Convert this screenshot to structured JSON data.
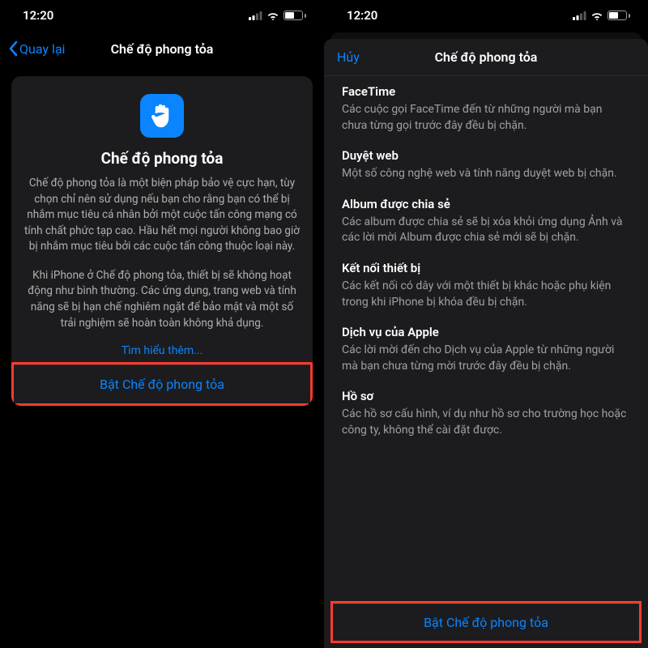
{
  "status": {
    "time": "12:20",
    "battery_pct": "48"
  },
  "left": {
    "nav_back": "Quay lại",
    "nav_title": "Chế độ phong tỏa",
    "card_title": "Chế độ phong tỏa",
    "card_para1": "Chế độ phong tỏa là một biện pháp bảo vệ cực hạn, tùy chọn chỉ nên sử dụng nếu bạn cho rằng bạn có thể bị nhắm mục tiêu cá nhân bởi một cuộc tấn công mạng có tính chất phức tạp cao. Hầu hết mọi người không bao giờ bị nhắm mục tiêu bởi các cuộc tấn công thuộc loại này.",
    "card_para2": "Khi iPhone ở Chế độ phong tỏa, thiết bị sẽ không hoạt động như bình thường. Các ứng dụng, trang web và tính năng sẽ bị hạn chế nghiêm ngặt để bảo mật và một số trải nghiệm sẽ hoàn toàn không khả dụng.",
    "learn_more": "Tìm hiểu thêm...",
    "action": "Bật Chế độ phong tỏa"
  },
  "right": {
    "cancel": "Hủy",
    "modal_title": "Chế độ phong tỏa",
    "sections": [
      {
        "title": "FaceTime",
        "text": "Các cuộc gọi FaceTime đến từ những người mà bạn chưa từng gọi trước đây đều bị chặn."
      },
      {
        "title": "Duyệt web",
        "text": "Một số công nghệ web và tính năng duyệt web bị chặn."
      },
      {
        "title": "Album được chia sẻ",
        "text": "Các album được chia sẻ sẽ bị xóa khỏi ứng dụng Ảnh và các lời mời Album được chia sẻ mới sẽ bị chặn."
      },
      {
        "title": "Kết nối thiết bị",
        "text": "Các kết nối có dây với một thiết bị khác hoặc phụ kiện trong khi iPhone bị khóa đều bị chặn."
      },
      {
        "title": "Dịch vụ của Apple",
        "text": "Các lời mời đến cho Dịch vụ của Apple từ những người mà bạn chưa từng mời trước đây đều bị chặn."
      },
      {
        "title": "Hồ sơ",
        "text": "Các hồ sơ cấu hình, ví dụ như hồ sơ cho trường học hoặc công ty, không thể cài đặt được."
      }
    ],
    "action": "Bật Chế độ phong tỏa"
  }
}
